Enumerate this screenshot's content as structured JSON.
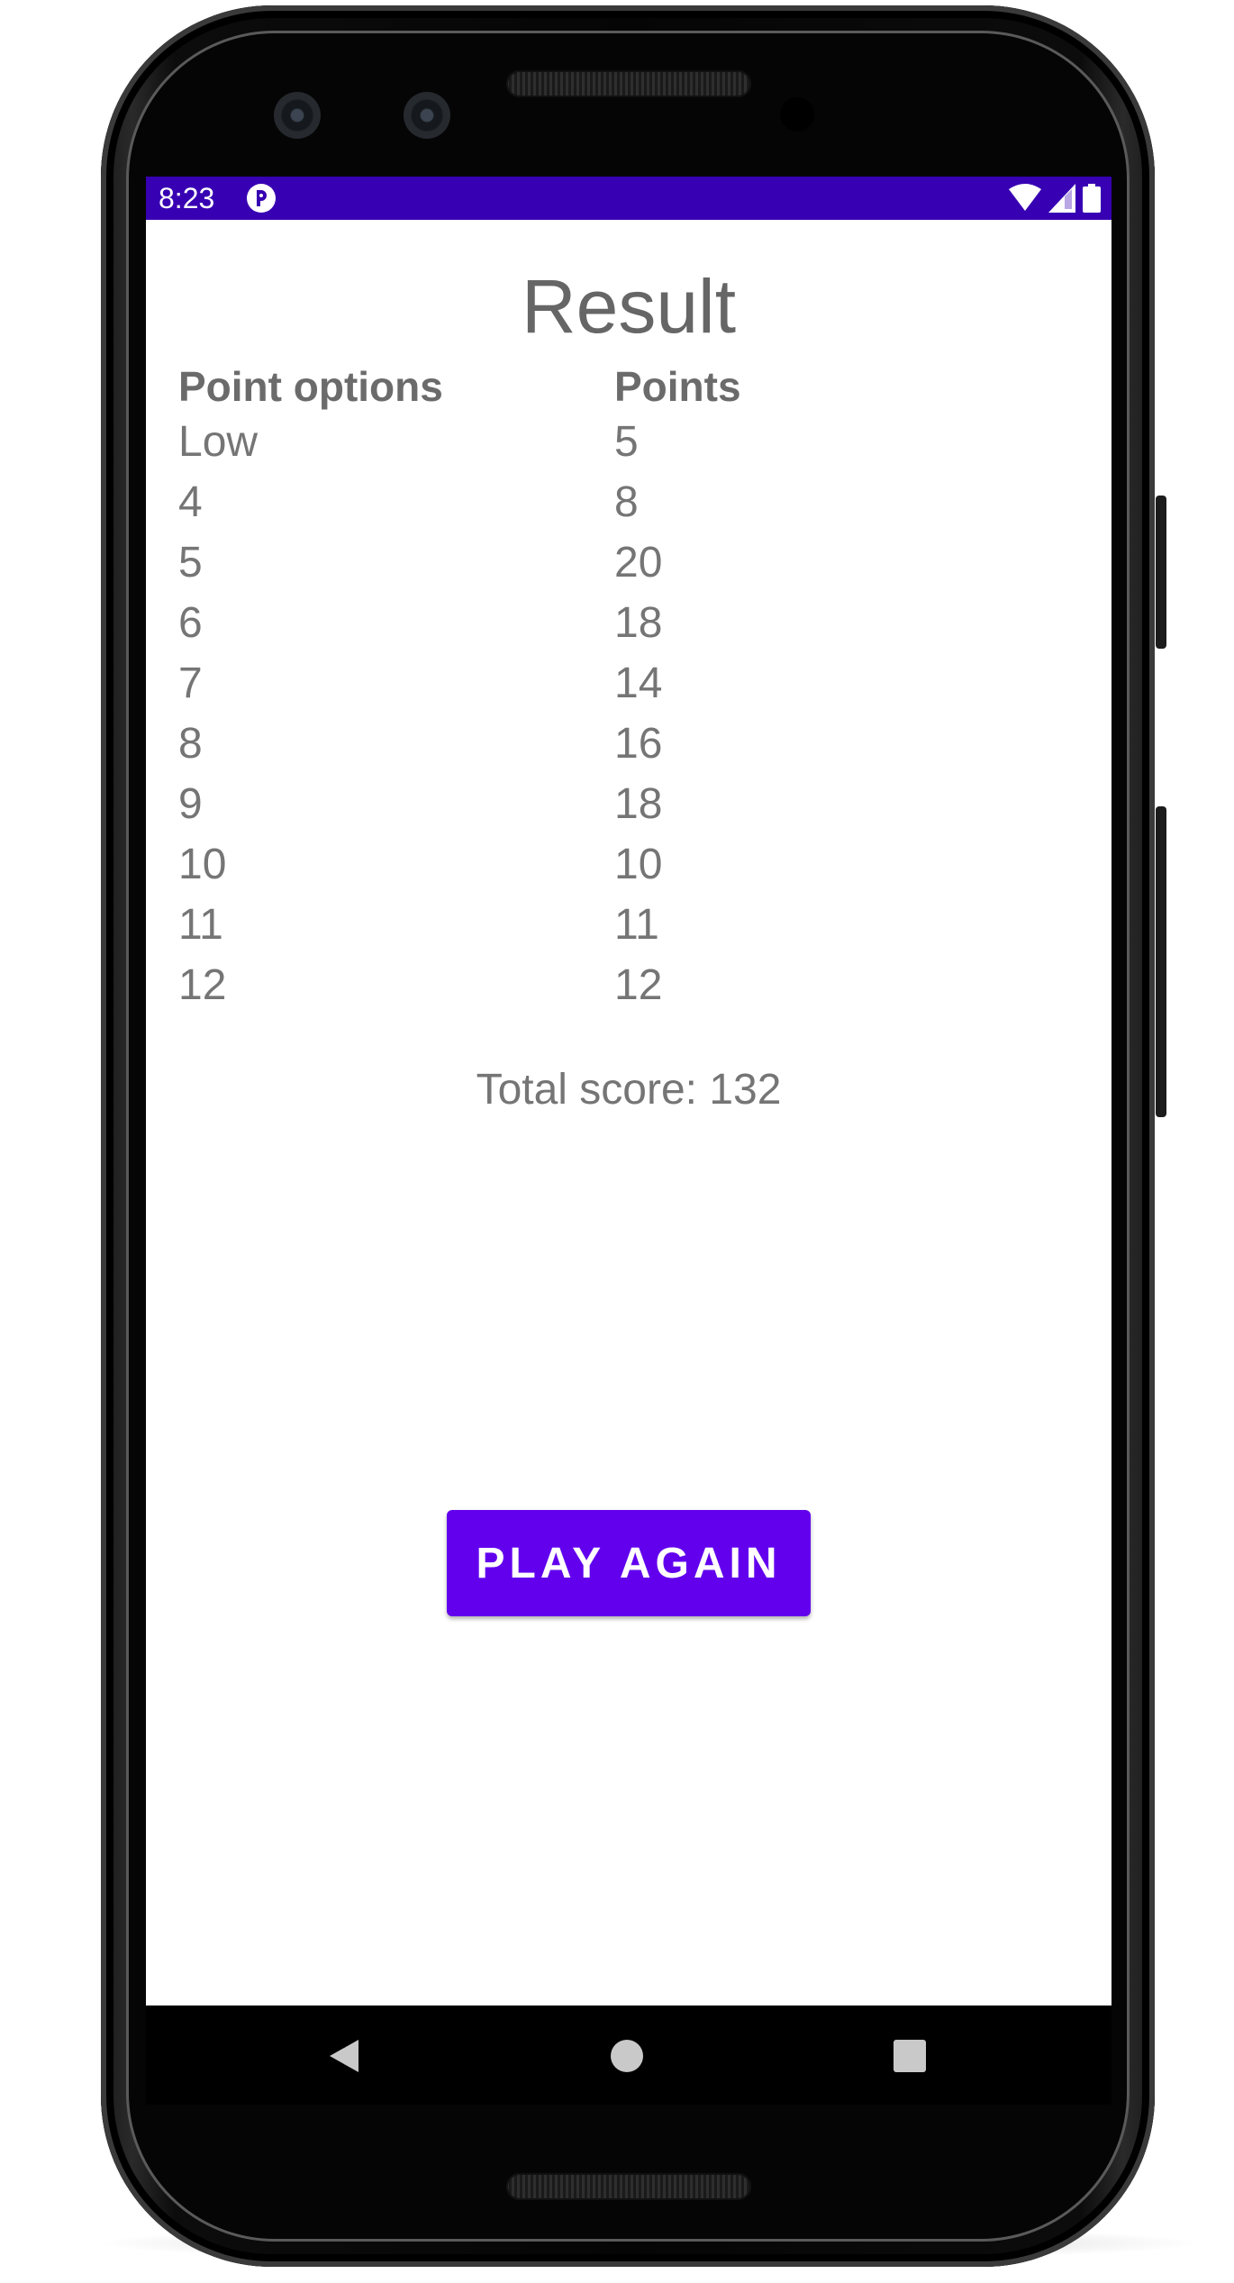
{
  "status_bar": {
    "time": "8:23",
    "color": "#3700b3"
  },
  "screen": {
    "title": "Result",
    "table": {
      "headers": [
        "Point options",
        "Points"
      ],
      "rows": [
        [
          "Low",
          "5"
        ],
        [
          "4",
          "8"
        ],
        [
          "5",
          "20"
        ],
        [
          "6",
          "18"
        ],
        [
          "7",
          "14"
        ],
        [
          "8",
          "16"
        ],
        [
          "9",
          "18"
        ],
        [
          "10",
          "10"
        ],
        [
          "11",
          "11"
        ],
        [
          "12",
          "12"
        ]
      ]
    },
    "total_score": "Total score: 132",
    "play_again_label": "PLAY AGAIN",
    "button_color": "#6200ee"
  },
  "nav_bar": {
    "icons": [
      "back-icon",
      "home-icon",
      "recents-icon"
    ]
  }
}
